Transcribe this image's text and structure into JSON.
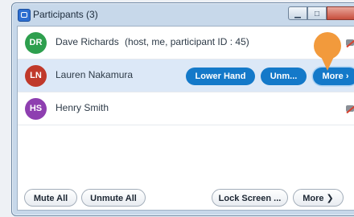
{
  "window": {
    "title": "Participants (3)"
  },
  "participants": [
    {
      "initials": "DR",
      "name": "Dave Richards",
      "detail": "(host, me, participant ID : 45)",
      "avatar_color": "#2e9f4e"
    },
    {
      "initials": "LN",
      "name": "Lauren Nakamura",
      "avatar_color": "#c0392b"
    },
    {
      "initials": "HS",
      "name": "Henry Smith",
      "avatar_color": "#8e3fb0"
    }
  ],
  "row_actions": {
    "lower_hand": "Lower Hand",
    "unmute": "Unm...",
    "more": "More ›"
  },
  "footer": {
    "mute_all": "Mute All",
    "unmute_all": "Unmute All",
    "lock_screen": "Lock Screen ...",
    "more": "More ❯"
  },
  "colors": {
    "accent": "#1479c9",
    "highlight_row": "#dce8f7",
    "pointer": "#f29a3c"
  }
}
